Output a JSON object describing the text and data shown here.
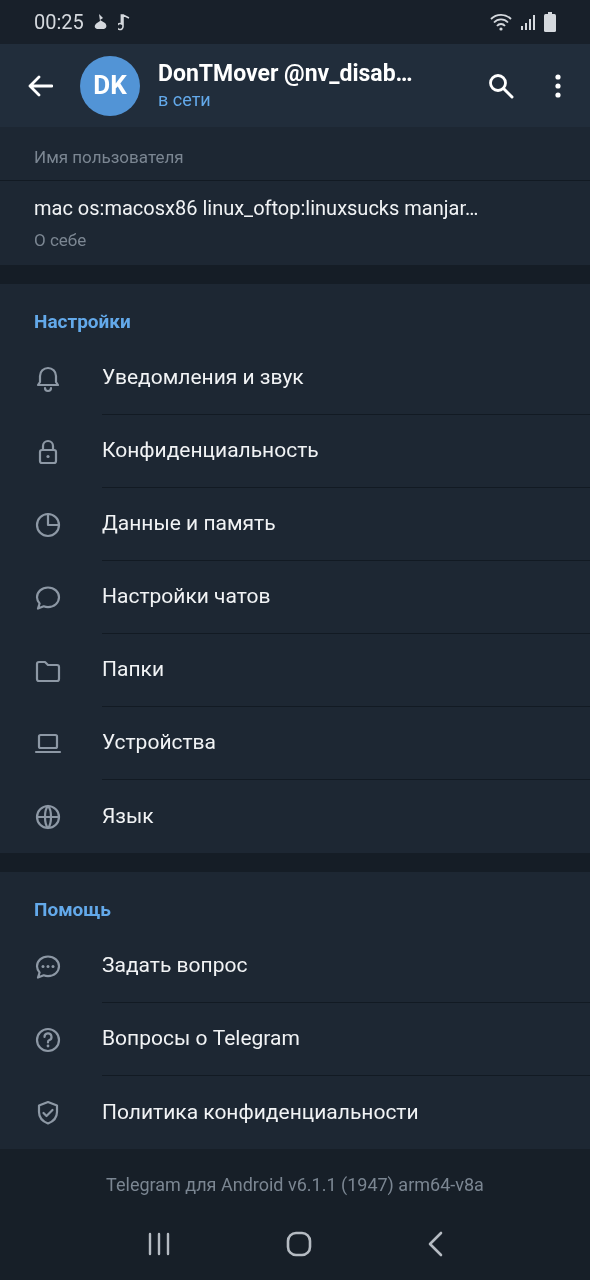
{
  "status_bar": {
    "time": "00:25"
  },
  "header": {
    "avatar": "DK",
    "title": "DonTMover @nv_disab…",
    "subtitle": "в сети"
  },
  "profile_fields": [
    {
      "label": "Имя пользователя"
    },
    {
      "value": "mac os:macosx86 linux_oftop:linuxsucks manjar…",
      "label": "О себе"
    }
  ],
  "sections": [
    {
      "title": "Настройки",
      "items": [
        {
          "label": "Уведомления и звук"
        },
        {
          "label": "Конфиденциальность"
        },
        {
          "label": "Данные и память"
        },
        {
          "label": "Настройки чатов"
        },
        {
          "label": "Папки"
        },
        {
          "label": "Устройства"
        },
        {
          "label": "Язык"
        }
      ]
    },
    {
      "title": "Помощь",
      "items": [
        {
          "label": "Задать вопрос"
        },
        {
          "label": "Вопросы о Telegram"
        },
        {
          "label": "Политика конфиденциальности"
        }
      ]
    }
  ],
  "footer": "Telegram для Android v6.1.1 (1947) arm64-v8a"
}
